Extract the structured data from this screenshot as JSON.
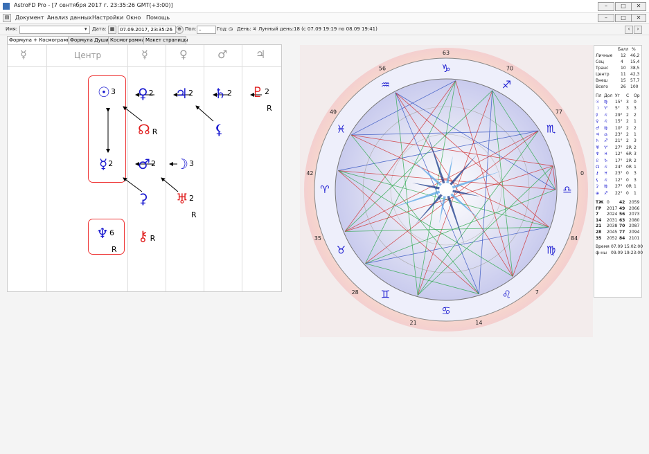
{
  "window": {
    "title": "AstroFD Pro - [7 сентября 2017 г. 23:35:26 GMT(+3:00)]",
    "btn_min": "–",
    "btn_max": "□",
    "btn_close": "✕"
  },
  "menu": [
    "Документ",
    "Анализ данных",
    "Настройки",
    "Окно",
    "Помощь"
  ],
  "toolbar": {
    "name_label": "Имя:",
    "date_label": "Дата:",
    "date_value": "07.09.2017, 23:35:26",
    "sex_label": "Пол:",
    "sex_value": "–",
    "year_label": "Год:",
    "day_label": "День:",
    "lunar_label": "Лунный день:",
    "lunar_value": "18 (с 07.09 19:19 по 08.09 19:41)"
  },
  "tabs": [
    "Формула + Космограмма",
    "Формула Души",
    "Космограмма",
    "Макет страницы"
  ],
  "formula": {
    "header_glyphs": [
      "☿",
      "☿",
      "♀",
      "♂",
      "♃"
    ],
    "center_label": "Центр",
    "rows": [
      {
        "glyph": "☉",
        "num": "3",
        "color": "blue"
      },
      {
        "glyph": "♀",
        "num": "2",
        "color": "blue"
      },
      {
        "glyph": "♃",
        "num": "2",
        "color": "blue"
      },
      {
        "glyph": "♄",
        "num": "2",
        "color": "blue"
      },
      {
        "glyph": "♇",
        "num": "2",
        "r": "R",
        "color": "red"
      },
      {
        "glyph": "☊",
        "r": "R",
        "color": "red"
      },
      {
        "glyph": "⚸",
        "color": "blue"
      },
      {
        "glyph": "☿",
        "num": "2",
        "color": "blue"
      },
      {
        "glyph": "♂",
        "num": "2",
        "color": "blue"
      },
      {
        "glyph": "☽",
        "num": "3",
        "color": "blue"
      },
      {
        "glyph": "⚳",
        "color": "blue"
      },
      {
        "glyph": "♅",
        "num": "2",
        "r": "R",
        "color": "red"
      },
      {
        "glyph": "♆",
        "num": "6",
        "r": "R",
        "color": "blue"
      },
      {
        "glyph": "⚷",
        "r": "R",
        "color": "red"
      }
    ]
  },
  "chart": {
    "degree_labels": [
      "63",
      "70",
      "77",
      "0",
      "84",
      "7",
      "14",
      "21",
      "28",
      "35",
      "42",
      "49",
      "56"
    ],
    "zodiac": [
      "♉",
      "♈",
      "♓",
      "♒",
      "♑",
      "♐",
      "♏",
      "♎",
      "♍",
      "♌",
      "♋",
      "♊"
    ]
  },
  "side": {
    "top_header": [
      "Балл",
      "%"
    ],
    "top_rows": [
      [
        "Личные",
        "12",
        "46,2"
      ],
      [
        "Соц",
        "4",
        "15,4"
      ],
      [
        "Транс",
        "10",
        "38,5"
      ],
      [
        "Центр",
        "11",
        "42,3"
      ],
      [
        "Внеш",
        "15",
        "57,7"
      ],
      [
        "Всего",
        "26",
        "100"
      ]
    ],
    "mid_header": [
      "Пл",
      "Дол",
      "Уг",
      "С",
      "Ор"
    ],
    "mid_rows": [
      [
        "☉",
        "♍",
        "15°",
        "3",
        "0"
      ],
      [
        "☽",
        "♈",
        "5°",
        "3",
        "3"
      ],
      [
        "☿",
        "♌",
        "29°",
        "2",
        "2"
      ],
      [
        "♀",
        "♌",
        "15°",
        "2",
        "1"
      ],
      [
        "♂",
        "♍",
        "10°",
        "2",
        "2"
      ],
      [
        "♃",
        "♎",
        "23°",
        "2",
        "1"
      ],
      [
        "♄",
        "♐",
        "21°",
        "2",
        "3"
      ],
      [
        "♅",
        "♈",
        "27°",
        "2R",
        "2"
      ],
      [
        "♆",
        "♓",
        "12°",
        "6R",
        "3"
      ],
      [
        "♇",
        "♑",
        "17°",
        "2R",
        "2"
      ],
      [
        "☊",
        "♌",
        "24°",
        "0R",
        "1"
      ],
      [
        "⚷",
        "♓",
        "23°",
        "0",
        "3"
      ],
      [
        "⚸",
        "♌",
        "12°",
        "0",
        "3"
      ],
      [
        "⚳",
        "♍",
        "27°",
        "0R",
        "1"
      ],
      [
        "⊕",
        "♐",
        "22°",
        "0",
        "1"
      ]
    ],
    "bottom_rows": [
      [
        "ТЖ",
        "0",
        "42",
        "2059"
      ],
      [
        "ГР",
        "2017",
        "49",
        "2066"
      ],
      [
        "7",
        "2024",
        "56",
        "2073"
      ],
      [
        "14",
        "2031",
        "63",
        "2080"
      ],
      [
        "21",
        "2038",
        "70",
        "2087"
      ],
      [
        "28",
        "2045",
        "77",
        "2094"
      ],
      [
        "35",
        "2052",
        "84",
        "2101"
      ]
    ],
    "time_rows": [
      [
        "Время",
        "07.09 15:02:00"
      ],
      [
        "ф-ны",
        "09.09 19:23:00"
      ]
    ]
  },
  "colors": {
    "blue": "#1a1ad0",
    "red": "#e02020",
    "chart_bg": "#f0e8e8"
  }
}
